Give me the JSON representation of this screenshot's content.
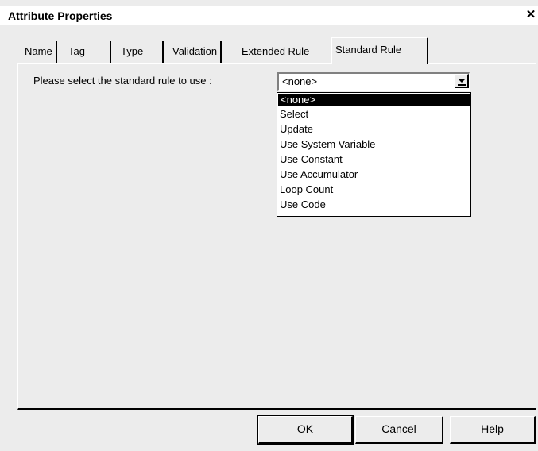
{
  "window": {
    "title": "Attribute Properties",
    "close_glyph": "✕"
  },
  "tabs": [
    {
      "label": "Name"
    },
    {
      "label": "Tag"
    },
    {
      "label": "Type"
    },
    {
      "label": "Validation"
    },
    {
      "label": "Extended Rule"
    },
    {
      "label": "Standard Rule",
      "active": true
    }
  ],
  "standard_rule": {
    "prompt": "Please select the standard rule to use :",
    "selected_value": "<none>",
    "options": [
      "<none>",
      "Select",
      "Update",
      "Use System Variable",
      "Use Constant",
      "Use Accumulator",
      "Loop Count",
      "Use Code"
    ],
    "dropdown_open": true
  },
  "buttons": {
    "ok": "OK",
    "cancel": "Cancel",
    "help": "Help"
  },
  "colors": {
    "background": "#ececec",
    "highlight": "#000000",
    "highlight_text": "#ffffff"
  }
}
